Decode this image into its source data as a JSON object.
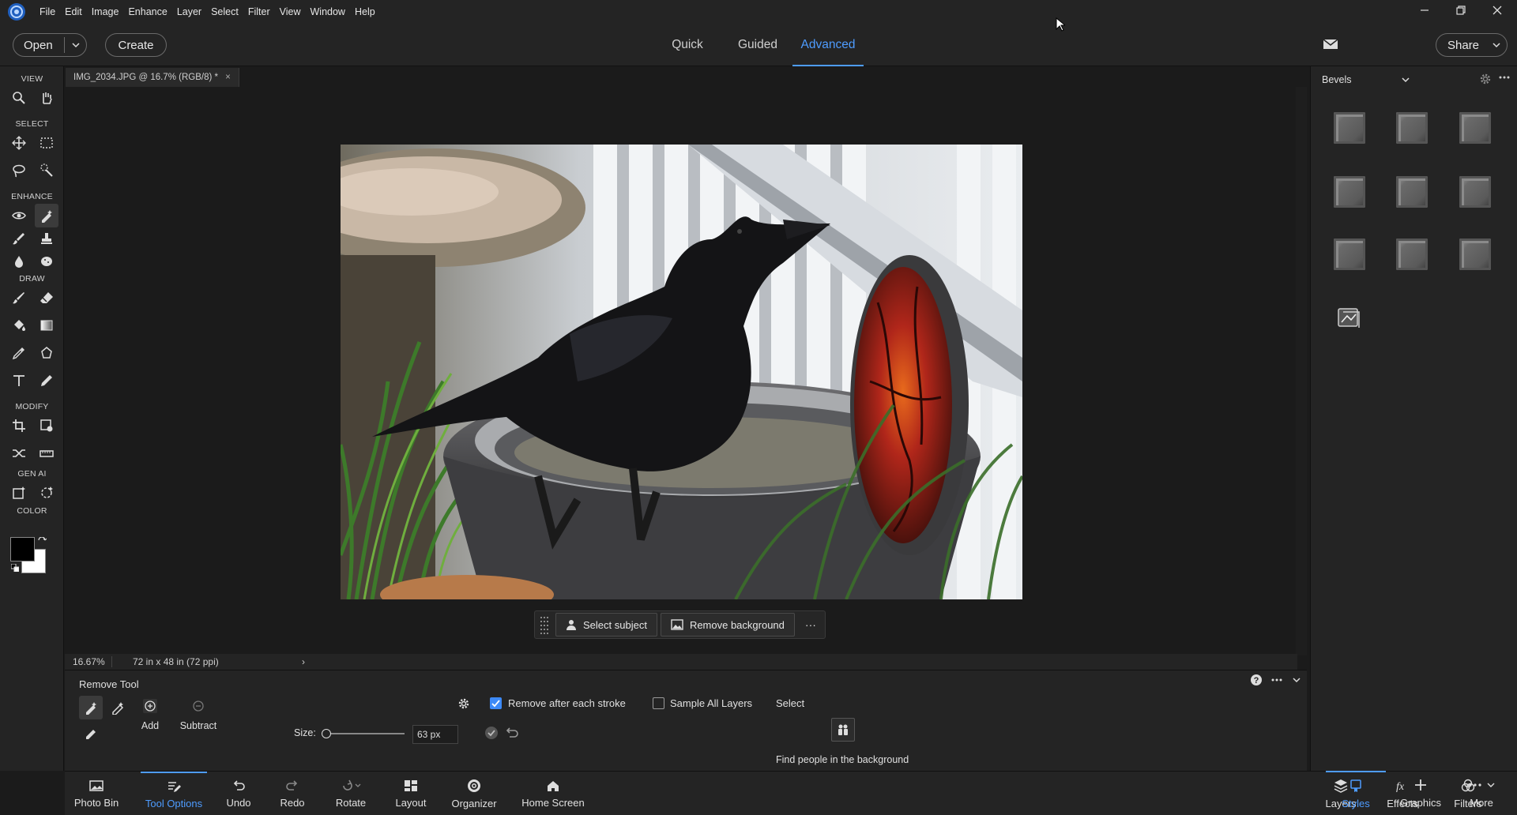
{
  "menubar": {
    "items": [
      "File",
      "Edit",
      "Image",
      "Enhance",
      "Layer",
      "Select",
      "Filter",
      "View",
      "Window",
      "Help"
    ]
  },
  "header": {
    "open_label": "Open",
    "create_label": "Create",
    "modes": [
      "Quick",
      "Guided",
      "Advanced"
    ],
    "active_mode": "Advanced",
    "share_label": "Share"
  },
  "toolbox": {
    "sections": [
      "VIEW",
      "SELECT",
      "ENHANCE",
      "DRAW",
      "MODIFY",
      "GEN AI",
      "COLOR"
    ]
  },
  "document": {
    "tab_title": "IMG_2034.JPG @ 16.7% (RGB/8) *",
    "close_glyph": "×"
  },
  "context_bar": {
    "select_subject": "Select subject",
    "remove_background": "Remove background",
    "more": "···"
  },
  "status": {
    "zoom": "16.67%",
    "dimensions": "72 in x 48 in (72 ppi)",
    "arrow": "›"
  },
  "right_panel": {
    "category": "Bevels"
  },
  "tool_options": {
    "title": "Remove Tool",
    "add_label": "Add",
    "subtract_label": "Subtract",
    "size_label": "Size:",
    "size_value": "63 px",
    "remove_after_stroke": "Remove after each stroke",
    "remove_after_stroke_checked": true,
    "sample_all_layers": "Sample All Layers",
    "sample_all_layers_checked": false,
    "select_label": "Select",
    "find_people": "Find people in the background"
  },
  "bottom_bar": {
    "left": [
      "Photo Bin",
      "Tool Options",
      "Undo",
      "Redo",
      "Rotate",
      "Layout",
      "Organizer",
      "Home Screen"
    ],
    "right": [
      "Layers",
      "Effects",
      "Filters",
      "Styles",
      "Graphics",
      "More"
    ],
    "active_left": "Tool Options",
    "active_right": "Styles"
  },
  "colors": {
    "accent": "#4e9cff",
    "foreground": "#000000",
    "background": "#ffffff"
  }
}
